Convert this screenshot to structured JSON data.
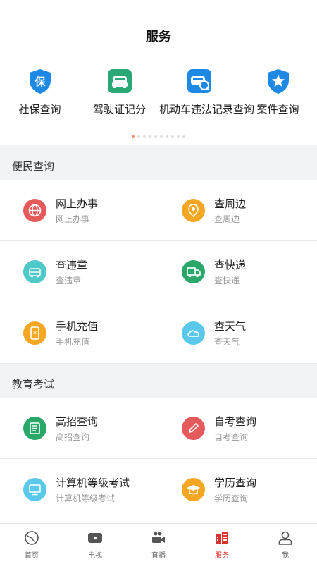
{
  "header": {
    "title": "服务"
  },
  "shortcuts": [
    {
      "label": "社保查询",
      "icon": "shield-bao-icon",
      "color": "#1e88e5"
    },
    {
      "label": "驾驶证记分",
      "icon": "car-front-icon",
      "color": "#2aa876"
    },
    {
      "label": "机动车违法记录查询",
      "icon": "car-search-icon",
      "color": "#1e88e5"
    },
    {
      "label": "案件查询",
      "icon": "star-badge-icon",
      "color": "#1e88e5"
    }
  ],
  "pager": {
    "count": 10,
    "active": 0
  },
  "sections": [
    {
      "title": "便民查询",
      "items": [
        {
          "title": "网上办事",
          "subtitle": "网上办事",
          "icon": "globe-icon",
          "color": "#e55a5a"
        },
        {
          "title": "查周边",
          "subtitle": "查周边",
          "icon": "map-pin-icon",
          "color": "#f5a623"
        },
        {
          "title": "查违章",
          "subtitle": "查违章",
          "icon": "car-icon",
          "color": "#4fc8c8"
        },
        {
          "title": "查快递",
          "subtitle": "查快递",
          "icon": "truck-icon",
          "color": "#2aa86a"
        },
        {
          "title": "手机充值",
          "subtitle": "手机充值",
          "icon": "phone-yuan-icon",
          "color": "#f5a623"
        },
        {
          "title": "查天气",
          "subtitle": "查天气",
          "icon": "weather-icon",
          "color": "#5ac8ea"
        }
      ]
    },
    {
      "title": "教育考试",
      "items": [
        {
          "title": "高招查询",
          "subtitle": "高招查询",
          "icon": "list-icon",
          "color": "#2aa86a"
        },
        {
          "title": "自考查询",
          "subtitle": "自考查询",
          "icon": "pencil-icon",
          "color": "#e55a5a"
        },
        {
          "title": "计算机等级考试",
          "subtitle": "计算机等级考试",
          "icon": "monitor-icon",
          "color": "#5ac8ea"
        },
        {
          "title": "学历查询",
          "subtitle": "学历查询",
          "icon": "graduation-cap-icon",
          "color": "#f5a623"
        }
      ]
    }
  ],
  "tabbar": [
    {
      "label": "首页",
      "icon": "globe-icon"
    },
    {
      "label": "电视",
      "icon": "play-icon"
    },
    {
      "label": "直播",
      "icon": "video-camera-icon"
    },
    {
      "label": "服务",
      "icon": "building-icon",
      "active": true
    },
    {
      "label": "我",
      "icon": "user-icon"
    }
  ],
  "colors": {
    "accent": "#d6342c",
    "active_dot": "#f08a6a"
  }
}
